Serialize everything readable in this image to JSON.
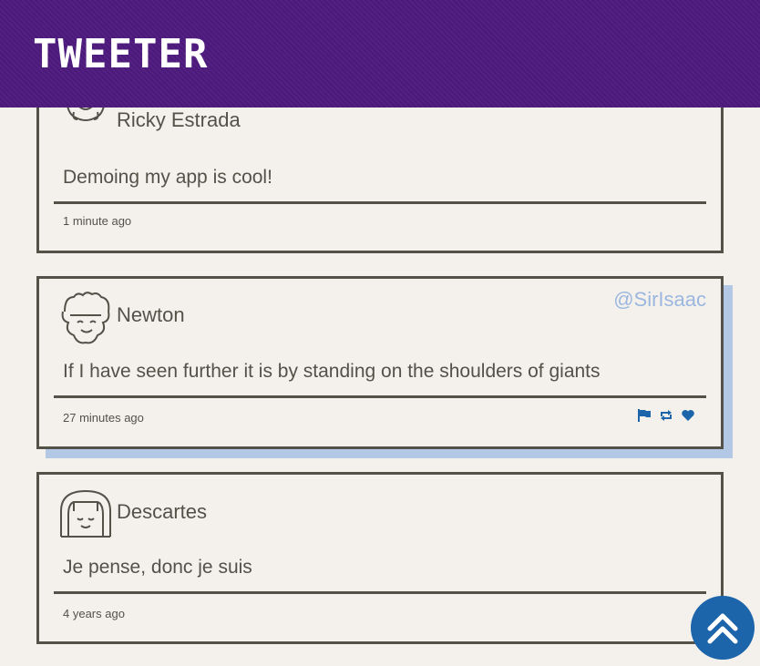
{
  "nav": {
    "brand": "Tweeter"
  },
  "tweets": [
    {
      "name": "Ricky Estrada",
      "content": "Demoing my app is cool!",
      "time": "1 minute ago",
      "avatar_icon": "smiling-face-avatar-icon"
    },
    {
      "name": "Newton",
      "handle": "@SirIsaac",
      "content": "If I have seen further it is by standing on the shoulders of giants",
      "time": "27 minutes ago",
      "avatar_icon": "curly-hair-avatar-icon",
      "actions": [
        "flag-icon",
        "retweet-icon",
        "heart-icon"
      ]
    },
    {
      "name": "Descartes",
      "content": "Je pense, donc je suis",
      "time": "4 years ago",
      "avatar_icon": "bob-hair-avatar-icon"
    }
  ],
  "colors": {
    "nav_bg": "#4c1a7d",
    "page_bg": "#f4f1ec",
    "text": "#545149",
    "handle": "#9bb7df",
    "accent": "#1d65ab",
    "shadow": "#b3c8e4"
  },
  "scroll_top_icon": "double-chevron-up-icon"
}
